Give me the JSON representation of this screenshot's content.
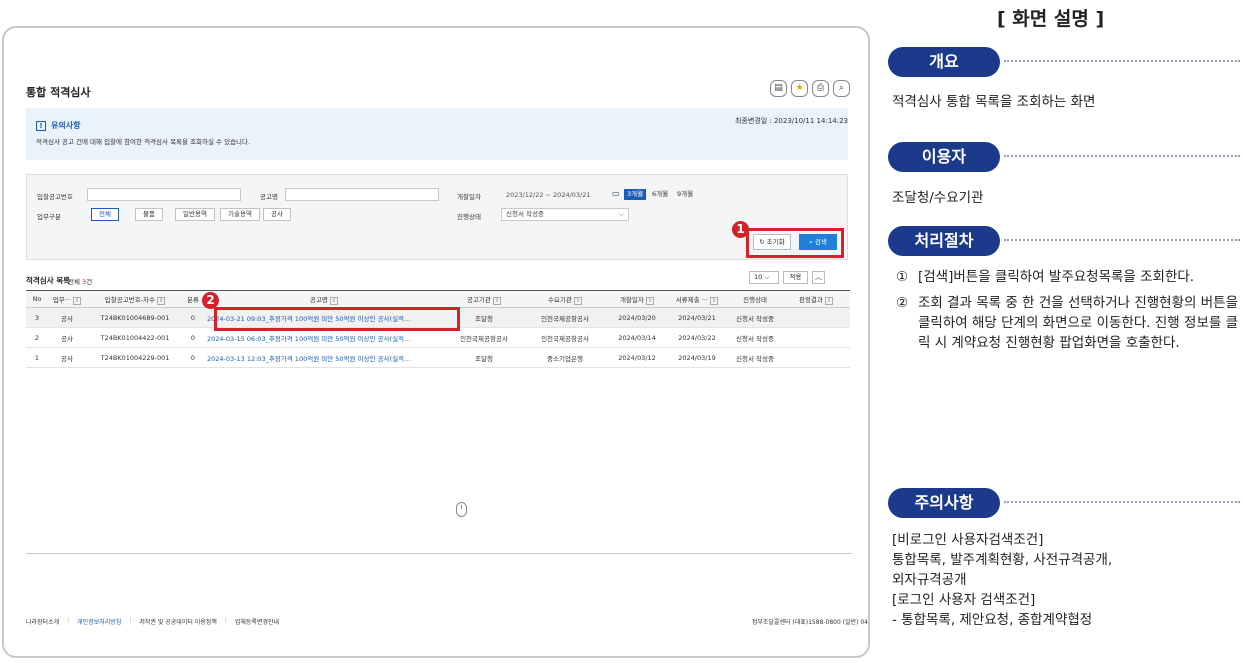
{
  "screen": {
    "page_title": "통합 적격심사",
    "last_modified": "최종변경일 : 2023/10/11 14:14:23",
    "title_icons": [
      "print-icon",
      "star-icon",
      "save-icon",
      "search-icon"
    ],
    "notice": {
      "heading": "유의사항",
      "text": "적격심사 공고 건에 대해 입찰에 참여한 적격심사 목록을 조회하실 수 있습니다."
    },
    "search": {
      "bid_no_label": "입찰공고번호",
      "bid_name_label": "공고명",
      "open_date_label": "개찰일자",
      "date_range": "2023/12/22  ~  2024/03/21",
      "periods": [
        "3개월",
        "6개월",
        "9개월"
      ],
      "active_period": "3개월",
      "business_label": "업무구분",
      "business_chips": [
        "전체",
        "물품",
        "일반용역",
        "기술용역",
        "공사"
      ],
      "status_label": "진행상태",
      "status_value": "신청서 작성중",
      "reset_label": "초기화",
      "search_label": "검색"
    },
    "list": {
      "title": "적격심사 목록",
      "count_prefix": "전체",
      "count": "3",
      "count_suffix": "건",
      "page_size": "10",
      "apply_label": "적용",
      "columns": [
        "No",
        "업무···",
        "입찰공고번호-차수",
        "분류",
        "공고명",
        "공고기관",
        "수요기관",
        "개찰일자",
        "서류제출 ···",
        "진행상태",
        "판정결과"
      ],
      "rows": [
        [
          "3",
          "공사",
          "T24BK01004689-001",
          "0",
          "2024-03-21 09:03_추정가격 100억원 미만 50억원 이상인 공사(실적…",
          "조달청",
          "인천국제공항공사",
          "2024/03/20",
          "2024/03/21",
          "신청서 작성중",
          ""
        ],
        [
          "2",
          "공사",
          "T24BK01004422-001",
          "0",
          "2024-03-15 06:03_추정가격 100억원 미만 50억원 이상인 공사(실적…",
          "인천국제공항공사",
          "인천국제공항공사",
          "2024/03/14",
          "2024/03/22",
          "신청서 작성중",
          ""
        ],
        [
          "1",
          "공사",
          "T24BK01004229-001",
          "0",
          "2024-03-13 12:03_추정가격 100억원 미만 50억원 이상인 공사(실적…",
          "조달청",
          "중소기업은행",
          "2024/03/12",
          "2024/03/19",
          "신청서 작성중",
          ""
        ]
      ]
    },
    "footer": {
      "links": [
        "나라장터소개",
        "개인정보처리방침",
        "저작권 및 공공데이터 이용정책",
        "업체등록변경안내"
      ],
      "contact": "정부조달콜센터  (대표)1588-0800  (일반) 04"
    },
    "markers": [
      "1",
      "2"
    ]
  },
  "description": {
    "title": "[ 화면 설명 ]",
    "overview_label": "개요",
    "overview_text": "적격심사 통합 목록을 조회하는 화면",
    "user_label": "이용자",
    "user_text": "조달청/수요기관",
    "process_label": "처리절차",
    "steps": [
      {
        "num": "①",
        "text": "[검색]버튼을 클릭하여 발주요청목록을 조회한다."
      },
      {
        "num": "②",
        "text": "조회 결과 목록 중 한 건을 선택하거나 진행현황의 버튼을 클릭하여 해당 단계의 화면으로 이동한다. 진행 정보를 클릭 시 계약요청 진행현황 팝업화면을 호출한다."
      }
    ],
    "caution_label": "주의사항",
    "caution_lines": [
      "[비로그인 사용자검색조건]",
      "통합목록, 발주계획현황, 사전규격공개,",
      "외자규격공개",
      "[로그인 사용자 검색조건]",
      "- 통합목록, 제안요청, 종합계약협정"
    ]
  }
}
